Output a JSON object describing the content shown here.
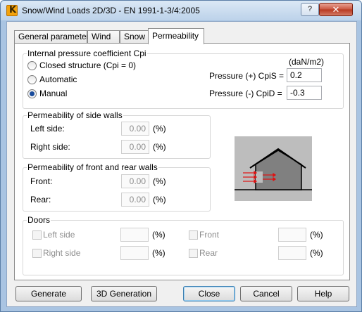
{
  "window": {
    "title": "Snow/Wind Loads 2D/3D - EN 1991-1-3/4:2005",
    "help_glyph": "?",
    "close_glyph": "✕"
  },
  "tabs": [
    {
      "label": "General parameters",
      "active": false
    },
    {
      "label": "Wind",
      "active": false
    },
    {
      "label": "Snow",
      "active": false
    },
    {
      "label": "Permeability",
      "active": true
    }
  ],
  "internal_pressure": {
    "group_label": "Internal pressure coefficient Cpi",
    "unit": "(daN/m2)",
    "options": [
      {
        "label": "Closed structure (Cpi = 0)",
        "selected": false
      },
      {
        "label": "Automatic",
        "selected": false
      },
      {
        "label": "Manual",
        "selected": true
      }
    ],
    "pressure_plus_label": "Pressure (+) CpiS =",
    "pressure_plus_value": "0.2",
    "pressure_minus_label": "Pressure (-) CpiD =",
    "pressure_minus_value": "-0.3"
  },
  "side_walls": {
    "group_label": "Permeability of side walls",
    "left_label": "Left side:",
    "left_value": "0.00",
    "right_label": "Right side:",
    "right_value": "0.00",
    "unit": "(%)"
  },
  "front_rear": {
    "group_label": "Permeability of front and rear walls",
    "front_label": "Front:",
    "front_value": "0.00",
    "rear_label": "Rear:",
    "rear_value": "0.00",
    "unit": "(%)"
  },
  "doors": {
    "group_label": "Doors",
    "left_side_label": "Left side",
    "right_side_label": "Right side",
    "front_label": "Front",
    "rear_label": "Rear",
    "unit": "(%)"
  },
  "buttons": {
    "generate": "Generate",
    "generation_3d": "3D Generation",
    "close": "Close",
    "cancel": "Cancel",
    "help": "Help"
  },
  "colors": {
    "accent": "#1a4c9c",
    "arrow": "#e01010",
    "house_fill": "#808080"
  }
}
